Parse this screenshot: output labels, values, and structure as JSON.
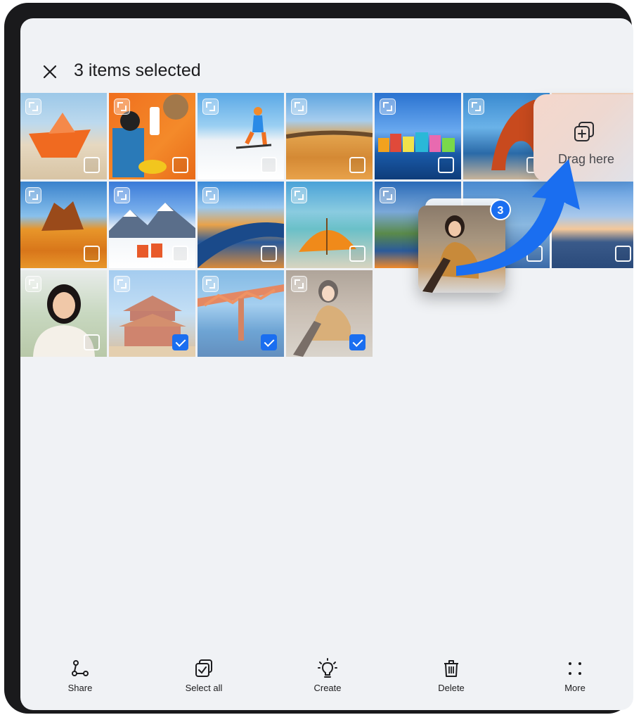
{
  "header": {
    "title": "3 items selected",
    "close_icon": "close-icon"
  },
  "drag_target": {
    "label": "Drag here",
    "icon": "add-to-album-icon"
  },
  "drag_count": "3",
  "accent": "#1a6ef0",
  "photos": [
    {
      "subject": "paper-boat",
      "selected": false
    },
    {
      "subject": "beach-flatlay",
      "selected": false
    },
    {
      "subject": "skier",
      "selected": false
    },
    {
      "subject": "desert-camels",
      "selected": false
    },
    {
      "subject": "colorful-houses",
      "selected": false
    },
    {
      "subject": "rock-arch",
      "selected": false
    },
    {
      "subject": "sunset-road",
      "selected": false
    },
    {
      "subject": "desert-rocks",
      "selected": false
    },
    {
      "subject": "snow-mountains",
      "selected": false
    },
    {
      "subject": "coastal-road",
      "selected": false
    },
    {
      "subject": "beach-umbrella",
      "selected": false
    },
    {
      "subject": "lake-shore",
      "selected": false
    },
    {
      "subject": "highway",
      "selected": false
    },
    {
      "subject": "woman-portrait",
      "selected": false
    },
    {
      "subject": "pagoda",
      "selected": true
    },
    {
      "subject": "bridge",
      "selected": true
    },
    {
      "subject": "woman-chair",
      "selected": true
    }
  ],
  "toolbar": {
    "share": "Share",
    "select_all": "Select all",
    "create": "Create",
    "delete": "Delete",
    "more": "More"
  }
}
